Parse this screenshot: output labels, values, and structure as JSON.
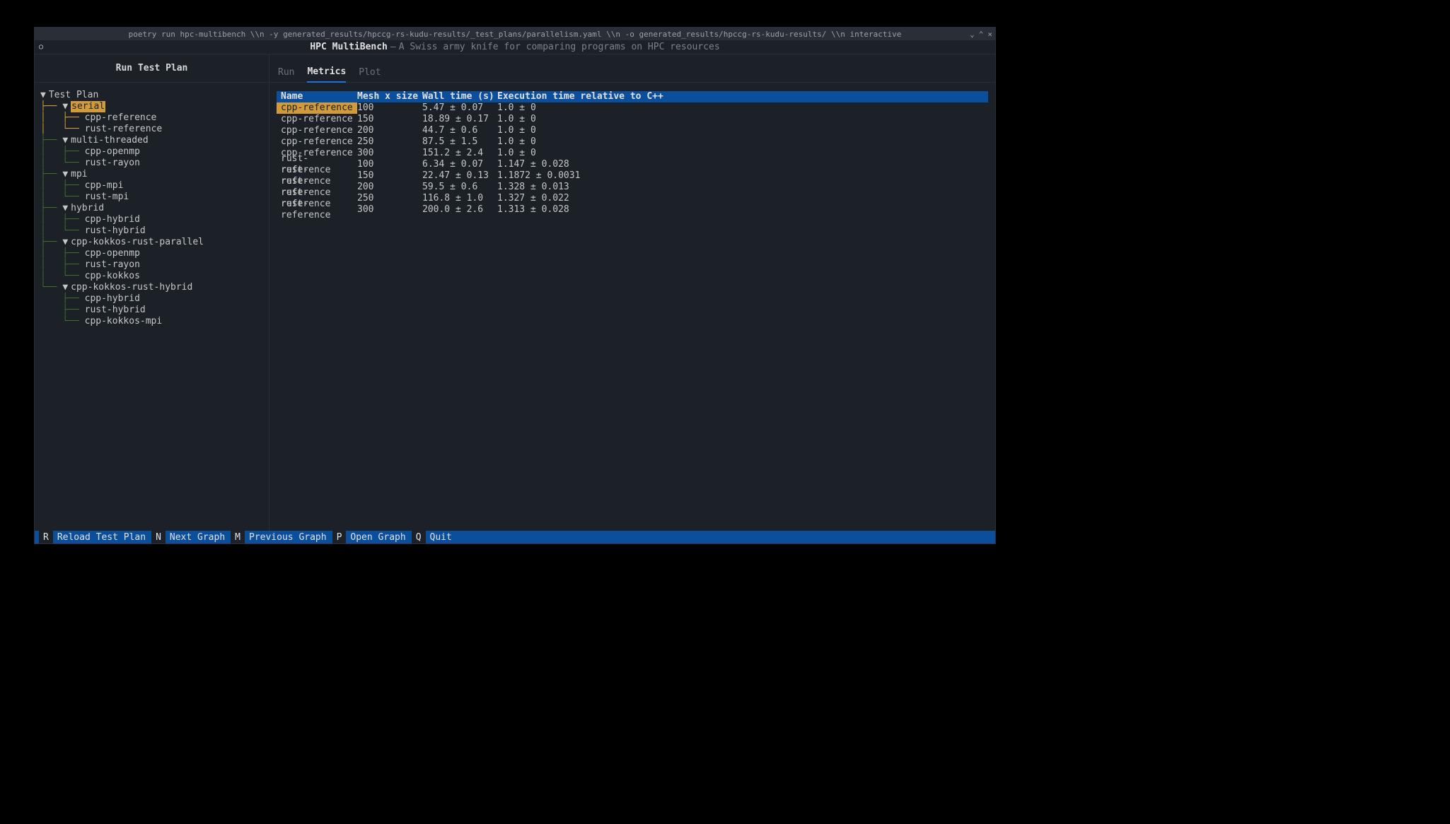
{
  "window": {
    "title": "poetry run hpc-multibench \\\\n -y generated_results/hpccg-rs-kudu-results/_test_plans/parallelism.yaml \\\\n -o generated_results/hpccg-rs-kudu-results/ \\\\n interactive",
    "controls": {
      "min": "⌄",
      "max": "⌃",
      "close": "×"
    }
  },
  "appbar": {
    "spinner": "○",
    "title": "HPC MultiBench",
    "sep": "—",
    "subtitle": "A Swiss army knife for comparing programs on HPC resources"
  },
  "sidebar": {
    "title": "Run Test Plan",
    "tree": [
      {
        "prefix": "",
        "caret": "▼",
        "label": "Test Plan",
        "selected": false,
        "prefix_hl": false
      },
      {
        "prefix": "├── ",
        "caret": "▼",
        "label": "serial",
        "selected": true,
        "prefix_hl": true
      },
      {
        "prefix": "│   ├── ",
        "caret": "",
        "label": "cpp-reference",
        "selected": false,
        "prefix_hl": true
      },
      {
        "prefix": "│   └── ",
        "caret": "",
        "label": "rust-reference",
        "selected": false,
        "prefix_hl": true
      },
      {
        "prefix": "├── ",
        "caret": "▼",
        "label": "multi-threaded",
        "selected": false,
        "prefix_hl": false
      },
      {
        "prefix": "│   ├── ",
        "caret": "",
        "label": "cpp-openmp",
        "selected": false,
        "prefix_hl": false
      },
      {
        "prefix": "│   └── ",
        "caret": "",
        "label": "rust-rayon",
        "selected": false,
        "prefix_hl": false
      },
      {
        "prefix": "├── ",
        "caret": "▼",
        "label": "mpi",
        "selected": false,
        "prefix_hl": false
      },
      {
        "prefix": "│   ├── ",
        "caret": "",
        "label": "cpp-mpi",
        "selected": false,
        "prefix_hl": false
      },
      {
        "prefix": "│   └── ",
        "caret": "",
        "label": "rust-mpi",
        "selected": false,
        "prefix_hl": false
      },
      {
        "prefix": "├── ",
        "caret": "▼",
        "label": "hybrid",
        "selected": false,
        "prefix_hl": false
      },
      {
        "prefix": "│   ├── ",
        "caret": "",
        "label": "cpp-hybrid",
        "selected": false,
        "prefix_hl": false
      },
      {
        "prefix": "│   └── ",
        "caret": "",
        "label": "rust-hybrid",
        "selected": false,
        "prefix_hl": false
      },
      {
        "prefix": "├── ",
        "caret": "▼",
        "label": "cpp-kokkos-rust-parallel",
        "selected": false,
        "prefix_hl": false
      },
      {
        "prefix": "│   ├── ",
        "caret": "",
        "label": "cpp-openmp",
        "selected": false,
        "prefix_hl": false
      },
      {
        "prefix": "│   ├── ",
        "caret": "",
        "label": "rust-rayon",
        "selected": false,
        "prefix_hl": false
      },
      {
        "prefix": "│   └── ",
        "caret": "",
        "label": "cpp-kokkos",
        "selected": false,
        "prefix_hl": false
      },
      {
        "prefix": "└── ",
        "caret": "▼",
        "label": "cpp-kokkos-rust-hybrid",
        "selected": false,
        "prefix_hl": false
      },
      {
        "prefix": "    ├── ",
        "caret": "",
        "label": "cpp-hybrid",
        "selected": false,
        "prefix_hl": false
      },
      {
        "prefix": "    ├── ",
        "caret": "",
        "label": "rust-hybrid",
        "selected": false,
        "prefix_hl": false
      },
      {
        "prefix": "    └── ",
        "caret": "",
        "label": "cpp-kokkos-mpi",
        "selected": false,
        "prefix_hl": false
      }
    ]
  },
  "tabs": [
    {
      "label": "Run",
      "active": false
    },
    {
      "label": "Metrics",
      "active": true
    },
    {
      "label": "Plot",
      "active": false
    }
  ],
  "table": {
    "headers": [
      "Name",
      "Mesh x size",
      "Wall time (s)",
      "Execution time relative to C++"
    ],
    "rows": [
      {
        "c": [
          "cpp-reference",
          "100",
          "5.47 ± 0.07",
          "1.0 ± 0"
        ],
        "selected": true
      },
      {
        "c": [
          "cpp-reference",
          "150",
          "18.89 ± 0.17",
          "1.0 ± 0"
        ],
        "selected": false
      },
      {
        "c": [
          "cpp-reference",
          "200",
          "44.7 ± 0.6",
          "1.0 ± 0"
        ],
        "selected": false
      },
      {
        "c": [
          "cpp-reference",
          "250",
          "87.5 ± 1.5",
          "1.0 ± 0"
        ],
        "selected": false
      },
      {
        "c": [
          "cpp-reference",
          "300",
          "151.2 ± 2.4",
          "1.0 ± 0"
        ],
        "selected": false
      },
      {
        "c": [
          "rust-reference",
          "100",
          "6.34 ± 0.07",
          "1.147 ± 0.028"
        ],
        "selected": false
      },
      {
        "c": [
          "rust-reference",
          "150",
          "22.47 ± 0.13",
          "1.1872 ± 0.0031"
        ],
        "selected": false
      },
      {
        "c": [
          "rust-reference",
          "200",
          "59.5 ± 0.6",
          "1.328 ± 0.013"
        ],
        "selected": false
      },
      {
        "c": [
          "rust-reference",
          "250",
          "116.8 ± 1.0",
          "1.327 ± 0.022"
        ],
        "selected": false
      },
      {
        "c": [
          "rust-reference",
          "300",
          "200.0 ± 2.6",
          "1.313 ± 0.028"
        ],
        "selected": false
      }
    ]
  },
  "statusbar": [
    {
      "key": "R",
      "label": "Reload Test Plan"
    },
    {
      "key": "N",
      "label": "Next Graph"
    },
    {
      "key": "M",
      "label": "Previous Graph"
    },
    {
      "key": "P",
      "label": "Open Graph"
    },
    {
      "key": "Q",
      "label": "Quit"
    }
  ]
}
